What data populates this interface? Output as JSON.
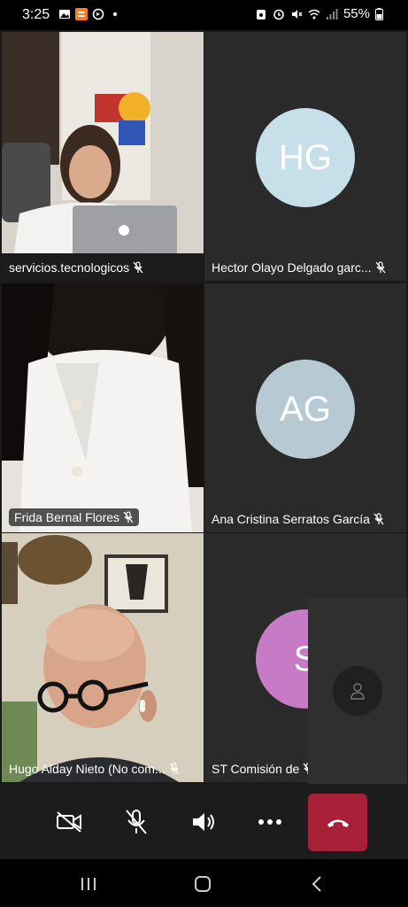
{
  "status_bar": {
    "time": "3:25",
    "battery": "55%",
    "left_icons": [
      "image-icon",
      "app-icon",
      "data-saver-icon",
      "dot-icon"
    ],
    "right_icons": [
      "alarm-icon",
      "clock-icon",
      "mute-icon",
      "wifi-icon",
      "signal-icon",
      "battery-icon"
    ]
  },
  "participants": [
    {
      "name": "servicios.tecnologicos",
      "initials": "",
      "video": true,
      "muted": true
    },
    {
      "name": "Hector Olayo Delgado garc...",
      "initials": "HG",
      "video": false,
      "muted": true,
      "avatar_color": "#c6dfe8"
    },
    {
      "name": "Frida Bernal Flores",
      "initials": "",
      "video": true,
      "muted": true
    },
    {
      "name": "Ana Cristina Serratos García",
      "initials": "AG",
      "video": false,
      "muted": true,
      "avatar_color": "#b7cad4"
    },
    {
      "name": "Hugo Alday Nieto (No com...",
      "initials": "",
      "video": true,
      "muted": true
    },
    {
      "name": "ST Comisión de",
      "initials": "S",
      "video": false,
      "muted": true,
      "avatar_color": "#c77ac6"
    }
  ],
  "self_view": {
    "icon": "person-icon"
  },
  "controls": {
    "camera": "camera-off-icon",
    "mic": "mic-off-icon",
    "speaker": "speaker-icon",
    "more": "more-icon",
    "hangup": "hang-up-icon",
    "hangup_color": "#a82038"
  },
  "navbar": {
    "recent": "recent-apps-icon",
    "home": "home-icon",
    "back": "back-icon"
  }
}
